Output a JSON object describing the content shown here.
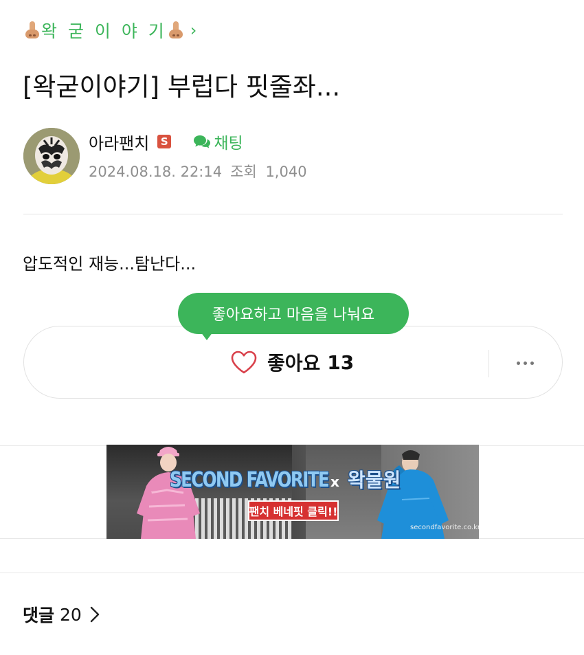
{
  "board": {
    "name": "왁 굳 이 야 기",
    "emoji_icon": "nose-emoji"
  },
  "post": {
    "title": "[왁굳이야기] 부럽다 핏줄좌...",
    "author": {
      "name": "아라팬치",
      "badge": "S",
      "badge_color": "#d9523f"
    },
    "chat_label": "채팅",
    "date": "2024.08.18. 22:14",
    "views_label": "조회",
    "views": "1,040",
    "body": "압도적인 재능...탐난다..."
  },
  "like": {
    "tooltip": "좋아요하고 마음을 나눠요",
    "label": "좋아요",
    "count": "13"
  },
  "banner": {
    "brand": "SECOND FAVORITE",
    "x": "x",
    "brand2": "왁물원",
    "cta": "팬치 베네핏 클릭!!",
    "url": "secondfavorite.co.kr"
  },
  "comments": {
    "label": "댓글",
    "count": "20"
  },
  "colors": {
    "accent": "#3cb55a",
    "meta": "#8f8f8f",
    "like_heart": "#d9414b"
  }
}
